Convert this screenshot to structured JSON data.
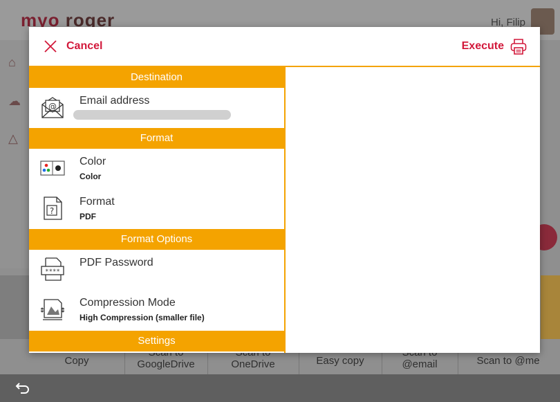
{
  "background": {
    "logo": {
      "part1": "myo",
      "part2": "roger"
    },
    "greeting": "Hi, Filip",
    "tiles": [
      {
        "label": "Copy"
      },
      {
        "label": "Scan to\nGoogleDrive"
      },
      {
        "label": "Scan to\nOneDrive"
      },
      {
        "label": "Easy copy"
      },
      {
        "label": "Scan to\n@email"
      },
      {
        "label": "Scan to @me"
      }
    ]
  },
  "modal": {
    "cancel_label": "Cancel",
    "execute_label": "Execute",
    "sections": {
      "destination": "Destination",
      "format": "Format",
      "format_options": "Format Options",
      "settings": "Settings"
    },
    "items": {
      "email": {
        "title": "Email address",
        "value": ""
      },
      "color": {
        "title": "Color",
        "value": "Color"
      },
      "format": {
        "title": "Format",
        "value": "PDF"
      },
      "pdf_password": {
        "title": "PDF Password",
        "value": ""
      },
      "compression": {
        "title": "Compression Mode",
        "value": "High Compression (smaller file)"
      }
    }
  },
  "colors": {
    "accent": "#f4a300",
    "brand_red": "#d2193b"
  }
}
